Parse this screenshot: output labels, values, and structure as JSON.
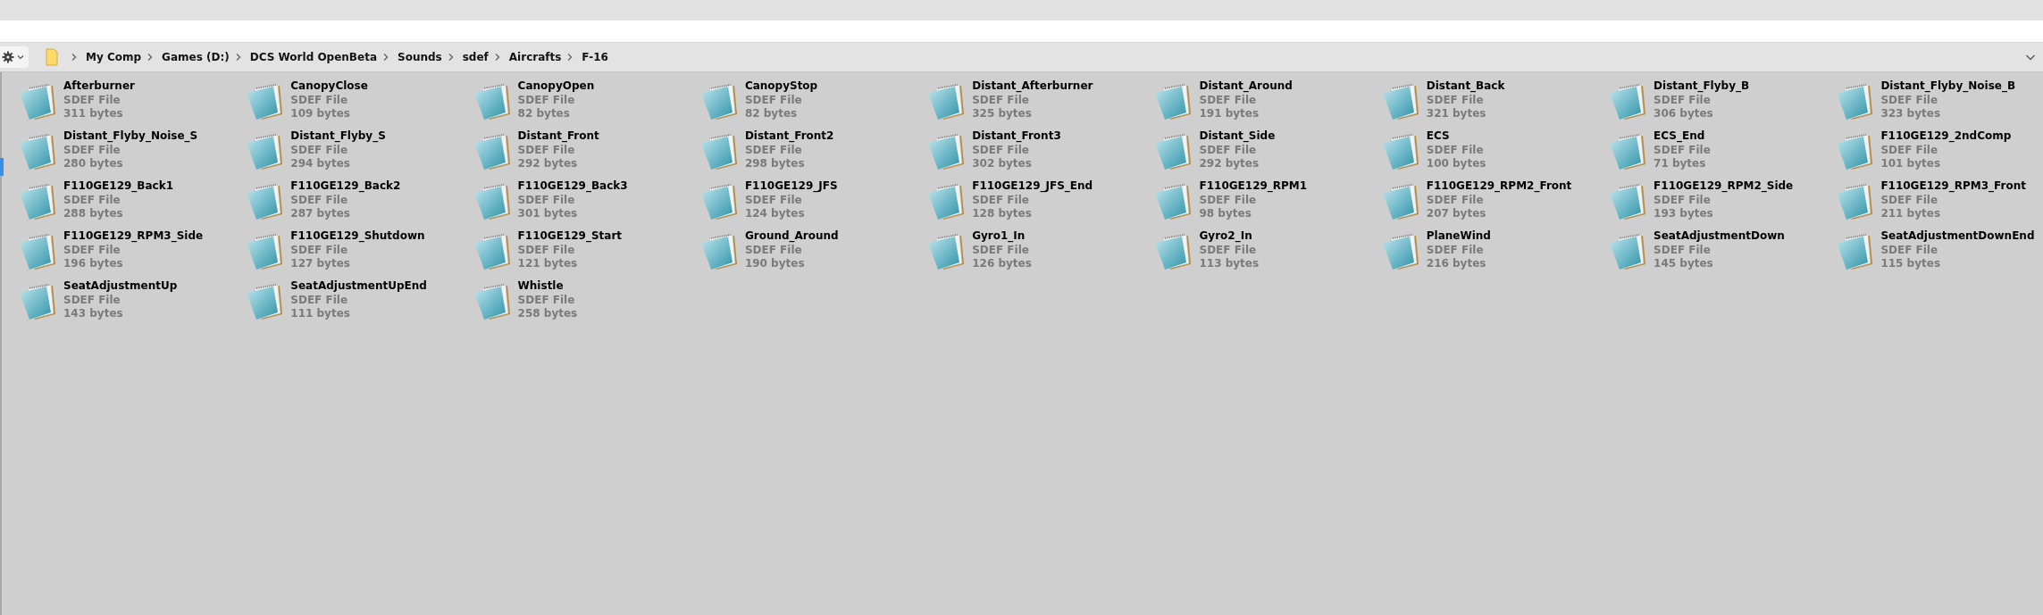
{
  "breadcrumb": [
    "My Comp",
    "Games (D:)",
    "DCS World OpenBeta",
    "Sounds",
    "sdef",
    "Aircrafts",
    "F-16"
  ],
  "files": [
    {
      "name": "Afterburner",
      "type": "SDEF File",
      "size": "311 bytes"
    },
    {
      "name": "CanopyClose",
      "type": "SDEF File",
      "size": "109 bytes"
    },
    {
      "name": "CanopyOpen",
      "type": "SDEF File",
      "size": "82 bytes"
    },
    {
      "name": "CanopyStop",
      "type": "SDEF File",
      "size": "82 bytes"
    },
    {
      "name": "Distant_Afterburner",
      "type": "SDEF File",
      "size": "325 bytes"
    },
    {
      "name": "Distant_Around",
      "type": "SDEF File",
      "size": "191 bytes"
    },
    {
      "name": "Distant_Back",
      "type": "SDEF File",
      "size": "321 bytes"
    },
    {
      "name": "Distant_Flyby_B",
      "type": "SDEF File",
      "size": "306 bytes"
    },
    {
      "name": "Distant_Flyby_Noise_B",
      "type": "SDEF File",
      "size": "323 bytes"
    },
    {
      "name": "Distant_Flyby_Noise_S",
      "type": "SDEF File",
      "size": "280 bytes"
    },
    {
      "name": "Distant_Flyby_S",
      "type": "SDEF File",
      "size": "294 bytes"
    },
    {
      "name": "Distant_Front",
      "type": "SDEF File",
      "size": "292 bytes"
    },
    {
      "name": "Distant_Front2",
      "type": "SDEF File",
      "size": "298 bytes"
    },
    {
      "name": "Distant_Front3",
      "type": "SDEF File",
      "size": "302 bytes"
    },
    {
      "name": "Distant_Side",
      "type": "SDEF File",
      "size": "292 bytes"
    },
    {
      "name": "ECS",
      "type": "SDEF File",
      "size": "100 bytes"
    },
    {
      "name": "ECS_End",
      "type": "SDEF File",
      "size": "71 bytes"
    },
    {
      "name": "F110GE129_2ndComp",
      "type": "SDEF File",
      "size": "101 bytes"
    },
    {
      "name": "F110GE129_Back1",
      "type": "SDEF File",
      "size": "288 bytes"
    },
    {
      "name": "F110GE129_Back2",
      "type": "SDEF File",
      "size": "287 bytes"
    },
    {
      "name": "F110GE129_Back3",
      "type": "SDEF File",
      "size": "301 bytes"
    },
    {
      "name": "F110GE129_JFS",
      "type": "SDEF File",
      "size": "124 bytes"
    },
    {
      "name": "F110GE129_JFS_End",
      "type": "SDEF File",
      "size": "128 bytes"
    },
    {
      "name": "F110GE129_RPM1",
      "type": "SDEF File",
      "size": "98 bytes"
    },
    {
      "name": "F110GE129_RPM2_Front",
      "type": "SDEF File",
      "size": "207 bytes"
    },
    {
      "name": "F110GE129_RPM2_Side",
      "type": "SDEF File",
      "size": "193 bytes"
    },
    {
      "name": "F110GE129_RPM3_Front",
      "type": "SDEF File",
      "size": "211 bytes"
    },
    {
      "name": "F110GE129_RPM3_Side",
      "type": "SDEF File",
      "size": "196 bytes"
    },
    {
      "name": "F110GE129_Shutdown",
      "type": "SDEF File",
      "size": "127 bytes"
    },
    {
      "name": "F110GE129_Start",
      "type": "SDEF File",
      "size": "121 bytes"
    },
    {
      "name": "Ground_Around",
      "type": "SDEF File",
      "size": "190 bytes"
    },
    {
      "name": "Gyro1_In",
      "type": "SDEF File",
      "size": "126 bytes"
    },
    {
      "name": "Gyro2_In",
      "type": "SDEF File",
      "size": "113 bytes"
    },
    {
      "name": "PlaneWind",
      "type": "SDEF File",
      "size": "216 bytes"
    },
    {
      "name": "SeatAdjustmentDown",
      "type": "SDEF File",
      "size": "145 bytes"
    },
    {
      "name": "SeatAdjustmentDownEnd",
      "type": "SDEF File",
      "size": "115 bytes"
    },
    {
      "name": "SeatAdjustmentUp",
      "type": "SDEF File",
      "size": "143 bytes"
    },
    {
      "name": "SeatAdjustmentUpEnd",
      "type": "SDEF File",
      "size": "111 bytes"
    },
    {
      "name": "Whistle",
      "type": "SDEF File",
      "size": "258 bytes"
    }
  ]
}
